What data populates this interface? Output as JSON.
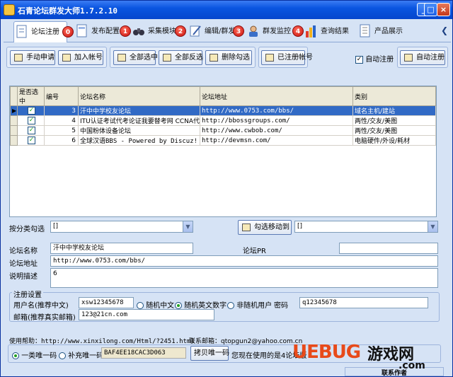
{
  "app": {
    "title": "石青论坛群发大师1.7.2.10"
  },
  "tabs": [
    {
      "label": "论坛注册",
      "badge": "0"
    },
    {
      "label": "发布配置",
      "badge": "1"
    },
    {
      "label": "采集模块",
      "badge": "2"
    },
    {
      "label": "编辑/群发",
      "badge": "3"
    },
    {
      "label": "群发监控",
      "badge": "4"
    },
    {
      "label": "查询结果"
    },
    {
      "label": "产品展示"
    }
  ],
  "toolbar": {
    "manual_apply": "手动申请",
    "add_account": "加入帐号",
    "select_all": "全部选中",
    "invert_select": "全部反选",
    "delete_checked": "删除勾选",
    "registered_accounts": "已注册帐号",
    "auto_register_check": "自动注册",
    "auto_register_btn": "自动注册"
  },
  "table": {
    "columns": [
      "是否选中",
      "编号",
      "论坛名称",
      "论坛地址",
      "类别"
    ],
    "rows": [
      {
        "id": "3",
        "name": "汗中中学校友论坛",
        "url": "http://www.0753.com/bbs/",
        "category": "域名主机/建站",
        "checked": "✓"
      },
      {
        "id": "4",
        "name": "ITU认证考试代考论证我要替考网 CCNA代考",
        "url": "http://bbossgroups.com/",
        "category": "两性/交友/美图",
        "checked": "✓"
      },
      {
        "id": "5",
        "name": "中国粉体设备论坛",
        "url": "http://www.cwbob.com/",
        "category": "两性/交友/美图",
        "checked": "✓"
      },
      {
        "id": "6",
        "name": "全球汉语BBS  - Powered by Discuz!",
        "url": "http://devmsn.com/",
        "category": "电脑硬件/外设/耗材",
        "checked": "✓"
      }
    ]
  },
  "filter": {
    "by_category_label": "按分类勾选",
    "category_value": "[]",
    "move_button": "勾选移动到",
    "move_value": "[]"
  },
  "detail": {
    "forum_name_label": "论坛名称",
    "forum_name": "汗中中学校友论坛",
    "forum_pr_label": "论坛PR",
    "forum_pr": "",
    "forum_url_label": "论坛地址",
    "forum_url": "http://www.0753.com/bbs/",
    "desc_label": "说明描述",
    "desc": "6"
  },
  "register": {
    "group_label": "注册设置",
    "username_label": "用户名(推荐中文)",
    "username": "xsw12345678",
    "radio_random_cn": "随机中文",
    "radio_random_en": "随机英文数字",
    "radio_non_random": "非随机用户",
    "password_label": "密码",
    "password": "q12345678",
    "email_label": "邮箱(推荐真实邮箱)",
    "email": "123@21cn.com"
  },
  "footer": {
    "help_text": "使用帮助：http://www.xinxilong.com/Html/?2451.html",
    "contact_text": "联系邮箱：qtopgun2@yahoo.com.cn",
    "radio_one_class": "一类唯一码",
    "radio_supplement": "补充唯一码",
    "code": "BAF4EE18CAC3D063",
    "copy_button": "拷贝唯一码",
    "using_text": "您现在使用的是4论坛版",
    "contact_author": "联系作者"
  },
  "watermark": {
    "brand": "UEBUG",
    "suffix": "游戏网",
    "domain": ".com"
  },
  "colors": {
    "title_bar": "#0a55e0",
    "selected_row": "#316ac5",
    "badge_red": "#d0140e",
    "window_bg": "#d6e3f5"
  }
}
